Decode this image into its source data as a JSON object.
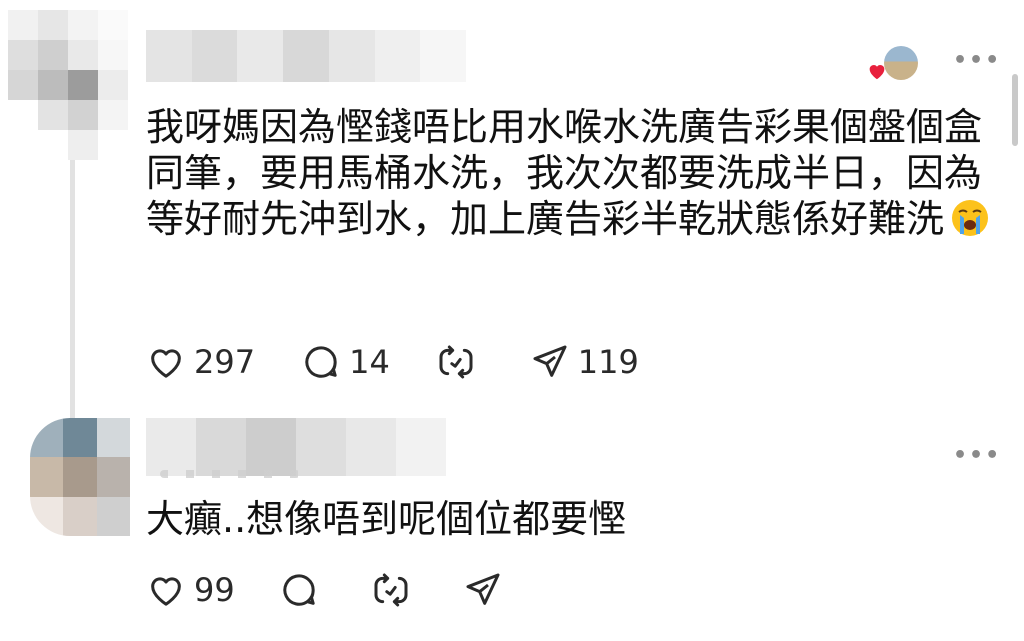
{
  "comments": [
    {
      "text": "我呀媽因為慳錢唔比用水喉水洗廣告彩果個盤個盒同筆，要用馬桶水洗，我次次都要洗成半日，因為等好耐先沖到水，加上廣告彩半乾狀態係好難洗",
      "emoji": "loudly-crying-face-icon",
      "likes": "297",
      "replies": "14",
      "reposts": "",
      "shares": "119"
    },
    {
      "text": "大癲..想像唔到呢個位都要慳",
      "likes": "99",
      "replies": "",
      "reposts": "",
      "shares": ""
    }
  ],
  "colors": {
    "text": "#111111",
    "icon": "#2a2a2a",
    "heart_badge": "#e8203d",
    "thread_line": "#e2e2e2"
  }
}
